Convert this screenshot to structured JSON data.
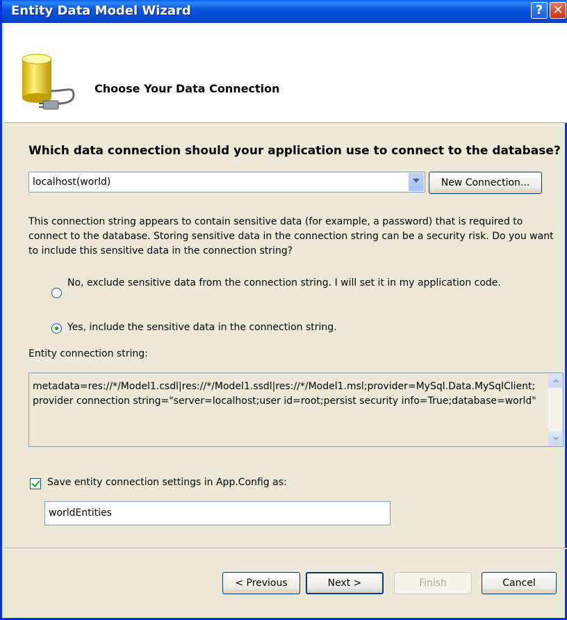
{
  "window": {
    "title": "Entity Data Model Wizard",
    "help_glyph": "?",
    "close_glyph": "✕"
  },
  "header": {
    "title": "Choose Your Data Connection",
    "icon": "database-plug-icon"
  },
  "connection": {
    "question": "Which data connection should your application use to connect to the database?",
    "selected": "localhost(world)",
    "new_connection_label": "New Connection..."
  },
  "sensitive": {
    "description": "This connection string appears to contain sensitive data (for example, a password) that is required to connect to the database. Storing sensitive data in the connection string can be a security risk. Do you want to include this sensitive data in the connection string?",
    "option_no": "No, exclude sensitive data from the connection string. I will set it in my application code.",
    "option_yes": "Yes, include the sensitive data in the connection string.",
    "selected": "yes"
  },
  "entity": {
    "label": "Entity connection string:",
    "value": "metadata=res://*/Model1.csdl|res://*/Model1.ssdl|res://*/Model1.msl;provider=MySql.Data.MySqlClient;provider connection string=\"server=localhost;user id=root;persist security info=True;database=world\""
  },
  "save": {
    "checked": true,
    "label": "Save entity connection settings in App.Config as:",
    "value": "worldEntities"
  },
  "buttons": {
    "previous": "< Previous",
    "next": "Next >",
    "finish": "Finish",
    "cancel": "Cancel"
  },
  "colors": {
    "titlebar": "#0a55dd",
    "dialog_bg": "#ece9d8",
    "accent_check": "#21a121"
  }
}
